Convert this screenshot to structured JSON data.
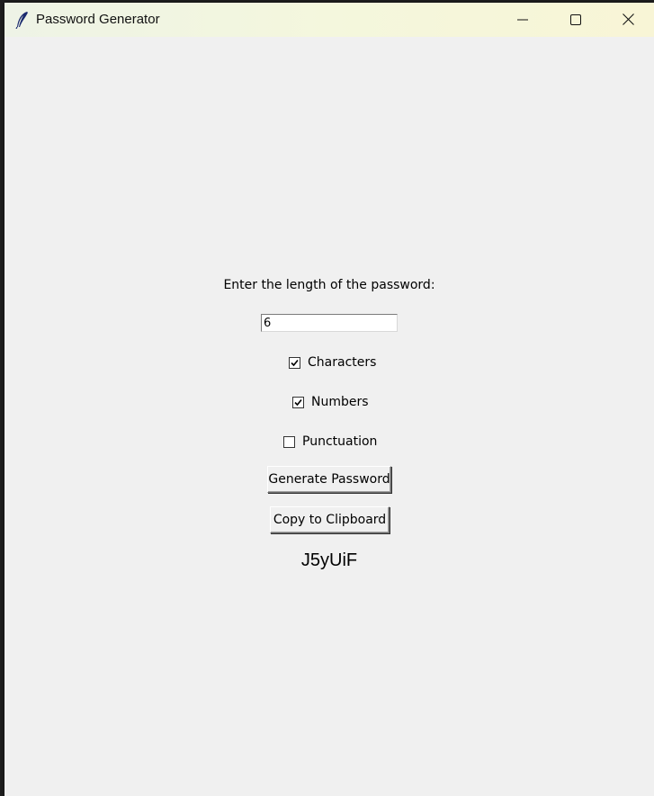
{
  "window": {
    "title": "Password Generator"
  },
  "form": {
    "length_label": "Enter the length of the password:",
    "length_value": "6",
    "options": [
      {
        "label": "Characters",
        "checked": true
      },
      {
        "label": "Numbers",
        "checked": true
      },
      {
        "label": "Punctuation",
        "checked": false
      }
    ],
    "generate_label": "Generate Password",
    "copy_label": "Copy to Clipboard",
    "result": "J5yUiF"
  },
  "icons": {
    "app": "feather-icon",
    "minimize": "minimize-icon",
    "maximize": "maximize-icon",
    "close": "close-icon",
    "check": "checkmark-icon"
  },
  "colors": {
    "window_bg": "#f0f0f0",
    "titlebar_bg": "#f4f7dd"
  }
}
